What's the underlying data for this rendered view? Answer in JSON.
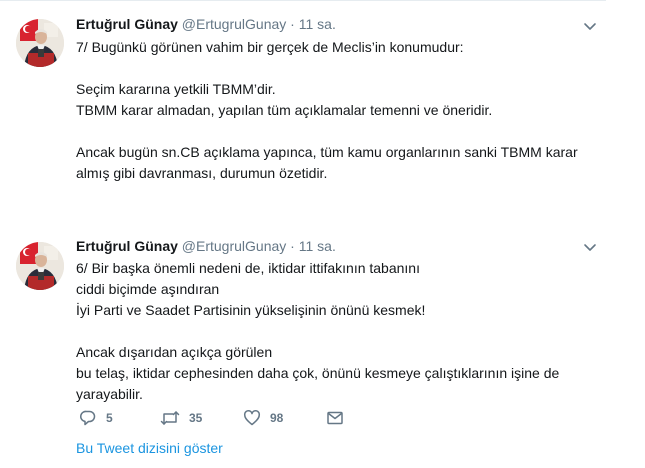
{
  "tweets": [
    {
      "author": {
        "name": "Ertuğrul Günay",
        "handle": "@ErtugrulGunay",
        "separator": "·",
        "time": "11 sa."
      },
      "lines": [
        "7/ Bugünkü görünen vahim bir gerçek de Meclis’in konumudur:",
        "",
        "Seçim kararına yetkili TBMM’dir.",
        "TBMM karar almadan, yapılan tüm açıklamalar temenni ve öneridir.",
        "",
        "Ancak bugün sn.CB açıklama yapınca, tüm kamu organlarının sanki TBMM karar",
        "almış gibi davranması, durumun özetidir."
      ],
      "icons": {
        "avatar": "profile-photo",
        "menu": "chevron-down-icon"
      }
    },
    {
      "author": {
        "name": "Ertuğrul Günay",
        "handle": "@ErtugrulGunay",
        "separator": "·",
        "time": "11 sa."
      },
      "lines": [
        "6/ Bir başka önemli nedeni de, iktidar ittifakının tabanını",
        "ciddi biçimde aşındıran",
        "İyi Parti ve Saadet Partisinin yükselişinin önünü kesmek!",
        "",
        "Ancak dışarıdan açıkça görülen",
        "bu telaş, iktidar cephesinden daha çok, önünü kesmeye çalıştıklarının işine de",
        "yarayabilir."
      ],
      "actions": {
        "replies": "5",
        "retweets": "35",
        "likes": "98"
      },
      "show_thread": "Bu Tweet dizisini göster",
      "icons": {
        "avatar": "profile-photo",
        "menu": "chevron-down-icon",
        "reply": "reply-icon",
        "retweet": "retweet-icon",
        "like": "heart-icon",
        "dm": "envelope-icon"
      }
    }
  ],
  "colors": {
    "text": "#14171a",
    "secondary": "#657786",
    "link": "#1b95e0",
    "border": "#e6ecf0"
  }
}
